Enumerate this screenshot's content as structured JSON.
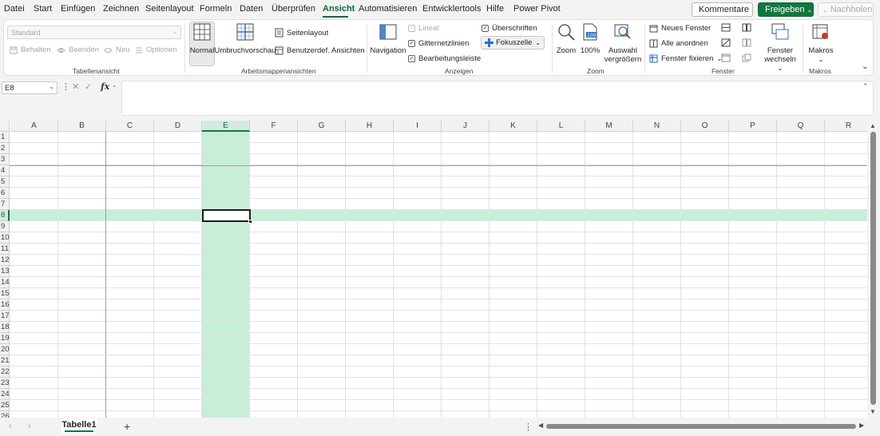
{
  "menu": {
    "items": [
      "Datei",
      "Start",
      "Einfügen",
      "Zeichnen",
      "Seitenlayout",
      "Formeln",
      "Daten",
      "Überprüfen",
      "Ansicht",
      "Automatisieren",
      "Entwicklertools",
      "Hilfe",
      "Power Pivot"
    ],
    "active": "Ansicht",
    "kommentare": "Kommentare",
    "freigeben": "Freigeben",
    "nachholen": "Nachholen"
  },
  "ribbon": {
    "tabellenansicht": {
      "style_value": "Standard",
      "behalten": "Behalten",
      "beenden": "Beenden",
      "neu": "Neu",
      "optionen": "Optionen",
      "label": "Tabellenansicht"
    },
    "arbeitsmappenansichten": {
      "normal": "Normal",
      "umbruch": "Umbruchvorschau",
      "seitenlayout": "Seitenlayout",
      "benutzerdef": "Benutzerdef. Ansichten",
      "label": "Arbeitsmappenansichten"
    },
    "anzeigen": {
      "navigation": "Navigation",
      "lineal": "Lineal",
      "gitternetzlinien": "Gitternetzlinien",
      "bearbeitungsleiste": "Bearbeitungsleiste",
      "ueberschriften": "Überschriften",
      "fokuszelle": "Fokuszelle",
      "label": "Anzeigen"
    },
    "zoom": {
      "zoom": "Zoom",
      "hundert": "100%",
      "auswahl_1": "Auswahl",
      "auswahl_2": "vergrößern",
      "label": "Zoom"
    },
    "fenster": {
      "neues_fenster": "Neues Fenster",
      "alle_anordnen": "Alle anordnen",
      "fenster_fixieren": "Fenster fixieren",
      "wechseln_1": "Fenster",
      "wechseln_2": "wechseln",
      "label": "Fenster"
    },
    "makros": {
      "makros": "Makros",
      "label": "Makros"
    }
  },
  "formula_bar": {
    "name_box": "E8",
    "fx": "fx",
    "value": ""
  },
  "grid": {
    "columns": [
      "A",
      "B",
      "C",
      "D",
      "E",
      "F",
      "G",
      "H",
      "I",
      "J",
      "K",
      "L",
      "M",
      "N",
      "O",
      "P",
      "Q",
      "R"
    ],
    "rows": [
      "1",
      "2",
      "3",
      "4",
      "5",
      "6",
      "7",
      "8",
      "9",
      "10",
      "11",
      "12",
      "13",
      "14",
      "15",
      "16",
      "17",
      "18",
      "19",
      "20",
      "21",
      "22",
      "23",
      "24",
      "25",
      "26"
    ],
    "selected_column": "E",
    "selected_row": "8"
  },
  "sheets": {
    "tabs": [
      "Tabelle1"
    ],
    "active": "Tabelle1",
    "add": "+"
  },
  "colors": {
    "accent": "#117740",
    "focus_highlight": "#c6eed9"
  }
}
